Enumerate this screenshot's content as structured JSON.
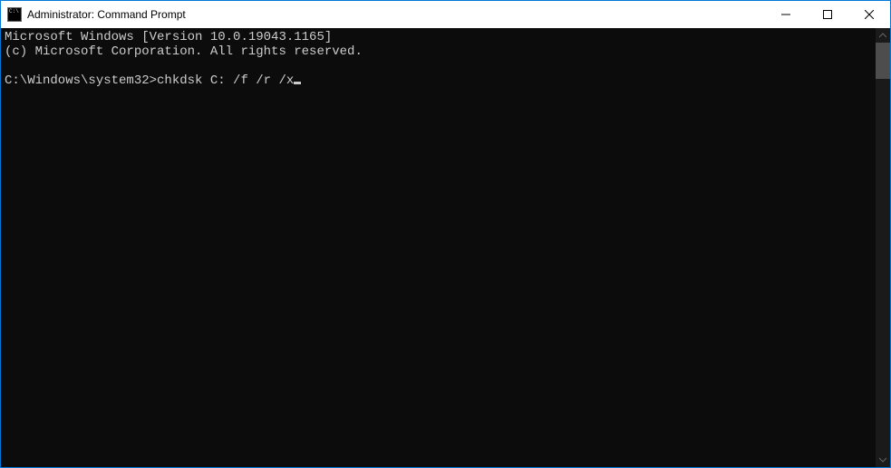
{
  "window": {
    "title": "Administrator: Command Prompt"
  },
  "terminal": {
    "line1": "Microsoft Windows [Version 10.0.19043.1165]",
    "line2": "(c) Microsoft Corporation. All rights reserved.",
    "blank": "",
    "prompt": "C:\\Windows\\system32>",
    "command": "chkdsk C: /f /r /x"
  }
}
